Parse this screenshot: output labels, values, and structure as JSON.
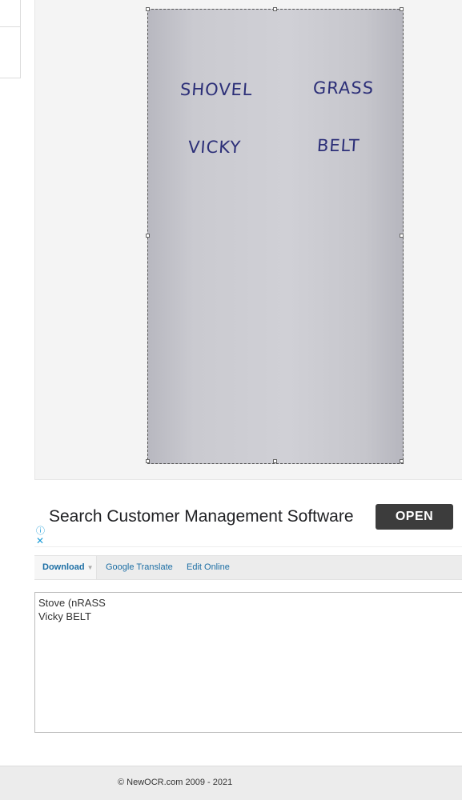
{
  "preview": {
    "handwritten_words": [
      "SHOVEL",
      "GRASS",
      "VICKY",
      "BELT"
    ]
  },
  "ad": {
    "headline": "Search Customer Management Software",
    "button_label": "OPEN",
    "info_icon": "info-icon",
    "close_icon": "close-icon",
    "info_glyph": "ⓘ",
    "close_glyph": "✕"
  },
  "toolbar": {
    "download_label": "Download",
    "download_caret": "▼",
    "translate_label": "Google Translate",
    "edit_label": "Edit Online"
  },
  "result": {
    "lines": [
      "Stove (nRASS",
      "Vicky BELT"
    ]
  },
  "footer": {
    "copyright": "© NewOCR.com 2009 - 2021"
  },
  "colors": {
    "link": "#1d6fa5",
    "ad_button_bg": "#3c3c3c",
    "ink": "#2c2f78",
    "ad_icon": "#1a9bd7"
  }
}
